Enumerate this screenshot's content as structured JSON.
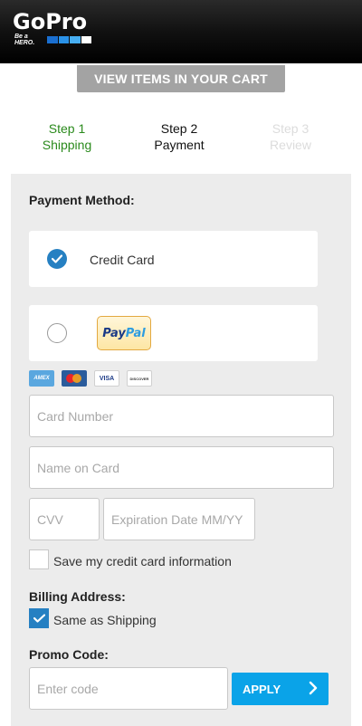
{
  "brand": {
    "name": "GoPro",
    "tagline": "Be a HERO."
  },
  "cart_button": {
    "label": "VIEW ITEMS IN YOUR CART"
  },
  "steps": [
    {
      "number": "Step 1",
      "label": "Shipping",
      "state": "completed"
    },
    {
      "number": "Step 2",
      "label": "Payment",
      "state": "current"
    },
    {
      "number": "Step 3",
      "label": "Review",
      "state": "upcoming"
    }
  ],
  "payment": {
    "title": "Payment Method:",
    "options": [
      {
        "label": "Credit Card",
        "selected": true
      },
      {
        "label": "PayPal",
        "selected": false
      }
    ],
    "card_brands": [
      "AMEX",
      "Mastercard",
      "VISA",
      "DISCOVER"
    ],
    "card_brand_labels": {
      "amex": "AMEX",
      "visa": "VISA",
      "discover": "DISCOVER"
    },
    "fields": {
      "card_number": {
        "value": "",
        "placeholder": "Card Number"
      },
      "name_on_card": {
        "value": "",
        "placeholder": "Name on Card"
      },
      "cvv": {
        "value": "",
        "placeholder": "CVV"
      },
      "expiration": {
        "value": "",
        "placeholder": "Expiration Date MM/YY"
      }
    },
    "save_card": {
      "label": "Save my credit card information",
      "checked": false
    }
  },
  "billing": {
    "title": "Billing Address:",
    "same_as_shipping": {
      "label": "Same as Shipping",
      "checked": true
    }
  },
  "promo": {
    "title": "Promo Code:",
    "field": {
      "value": "",
      "placeholder": "Enter code"
    },
    "apply_label": "APPLY"
  },
  "colors": {
    "accent_blue": "#2680c2",
    "apply_blue": "#0aa3e8",
    "step_complete_green": "#2a8a1c",
    "step_upcoming_gray": "#dcdcdc",
    "cart_button_gray": "#a3a3a3",
    "panel_bg": "#ececec"
  },
  "icons": {
    "check": "checkmark-icon",
    "chevron": "chevron-right-icon"
  }
}
